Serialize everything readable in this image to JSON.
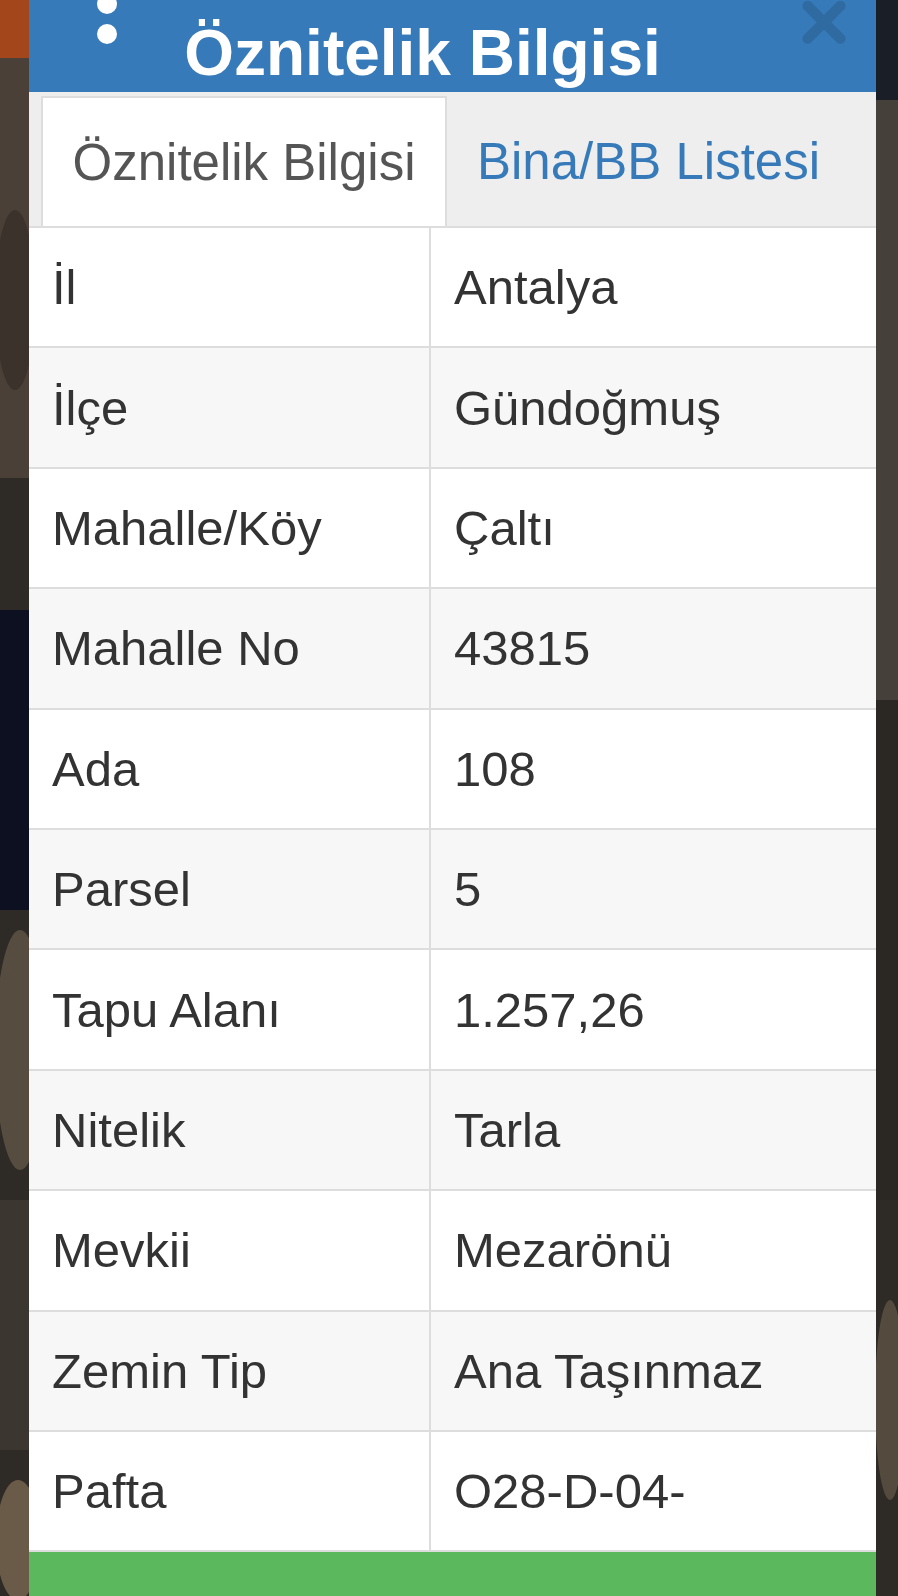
{
  "dialog": {
    "title": "Öznitelik Bilgisi",
    "tabs": [
      {
        "label": "Öznitelik Bilgisi",
        "selected": true
      },
      {
        "label": "Bina/BB Listesi",
        "selected": false
      }
    ],
    "rows": [
      {
        "label": "İl",
        "value": "Antalya"
      },
      {
        "label": "İlçe",
        "value": "Gündoğmuş"
      },
      {
        "label": "Mahalle/Köy",
        "value": "Çaltı"
      },
      {
        "label": "Mahalle No",
        "value": "43815"
      },
      {
        "label": "Ada",
        "value": "108"
      },
      {
        "label": "Parsel",
        "value": "5"
      },
      {
        "label": "Tapu Alanı",
        "value": "1.257,26"
      },
      {
        "label": "Nitelik",
        "value": "Tarla"
      },
      {
        "label": "Mevkii",
        "value": "Mezarönü"
      },
      {
        "label": "Zemin Tip",
        "value": "Ana Taşınmaz"
      },
      {
        "label": "Pafta",
        "value": "O28-D-04-"
      }
    ]
  }
}
